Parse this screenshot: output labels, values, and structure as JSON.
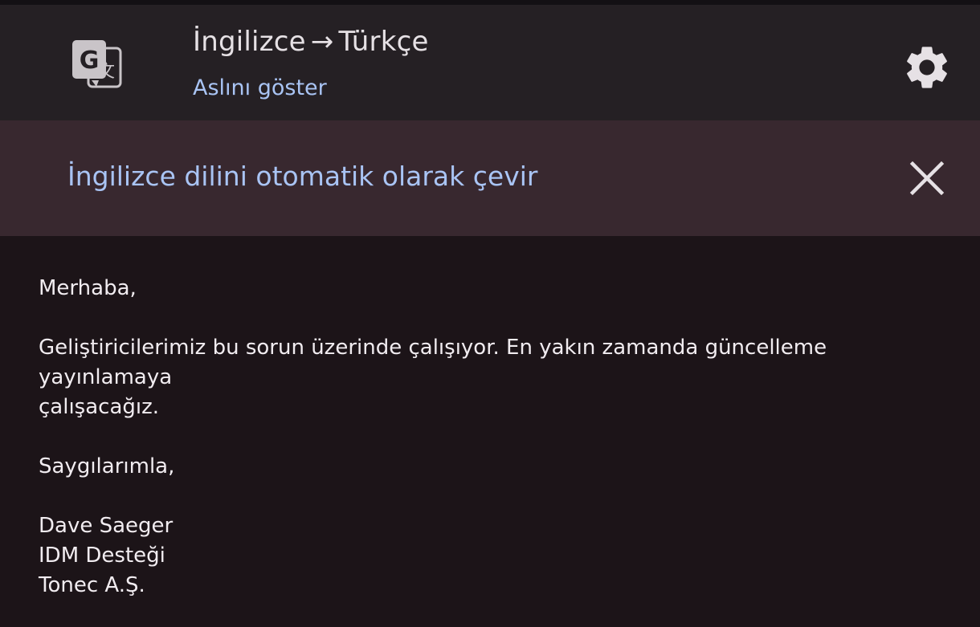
{
  "header": {
    "source_lang": "İngilizce",
    "arrow": "→",
    "target_lang": "Türkçe",
    "show_original": "Aslını göster",
    "translate_icon": "google-translate-icon",
    "settings_icon": "gear-icon"
  },
  "banner": {
    "text": "İngilizce dilini otomatik olarak çevir",
    "close_icon": "close-icon"
  },
  "message": {
    "greeting": "Merhaba,",
    "body_line1": "Geliştiricilerimiz bu sorun üzerinde çalışıyor. En yakın zamanda güncelleme yayınlamaya",
    "body_line2": "çalışacağız.",
    "closing": "Saygılarımla,",
    "signature_name": "Dave Saeger",
    "signature_team": "IDM Desteği",
    "signature_company": "Tonec A.Ş."
  },
  "colors": {
    "background": "#1c1418",
    "header": "#252024",
    "banner": "#38282f",
    "accent": "#a9c4f4",
    "text": "#f1ecf0"
  }
}
